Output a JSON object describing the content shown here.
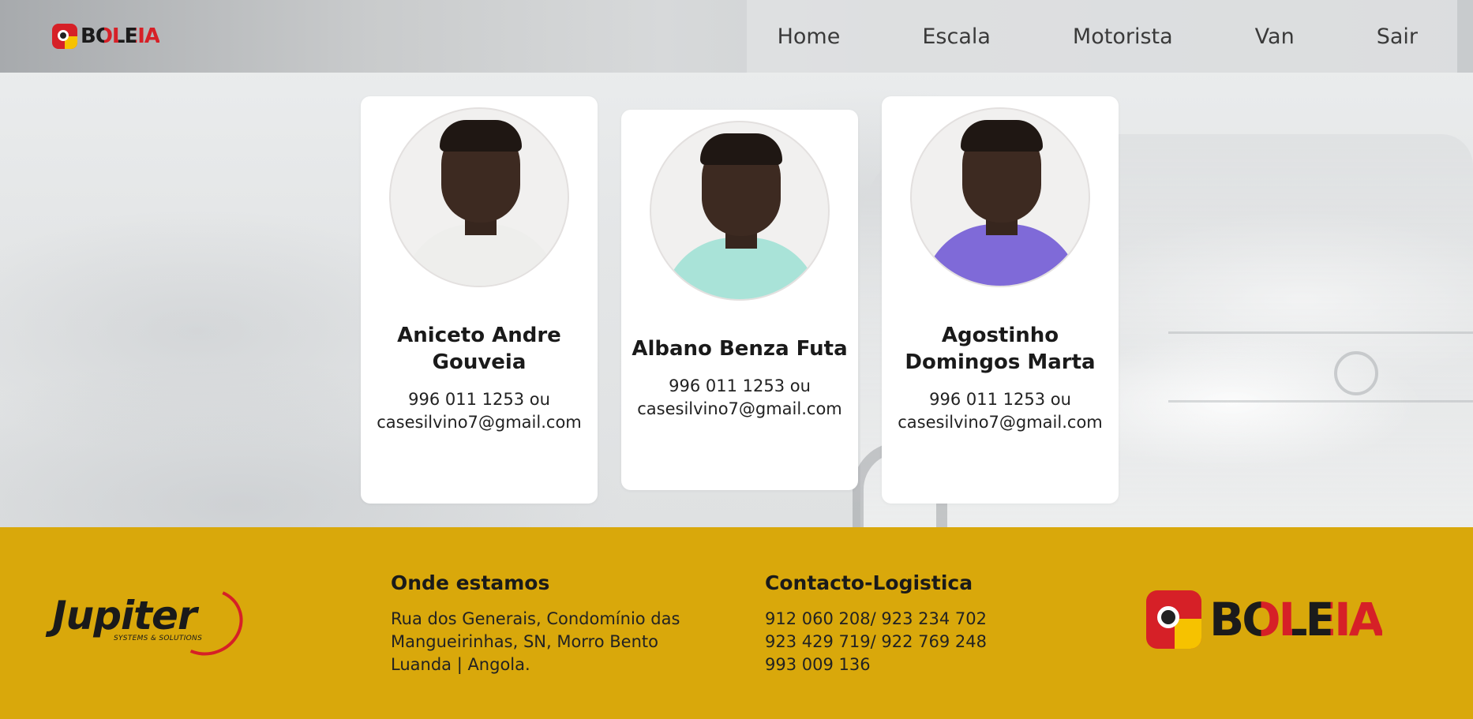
{
  "header": {
    "logo_text": "BOLEIA",
    "nav": [
      {
        "label": "Home"
      },
      {
        "label": "Escala"
      },
      {
        "label": "Motorista"
      },
      {
        "label": "Van"
      },
      {
        "label": "Sair"
      }
    ]
  },
  "drivers": [
    {
      "name_line1": "Aniceto Andre",
      "name_line2": "Gouveia",
      "phone": "996 011 1253 ou",
      "email": "casesilvino7@gmail.com",
      "shirt_color": "#eeeeec"
    },
    {
      "name_line1": "Albano Benza Futa",
      "name_line2": "",
      "phone": "996 011 1253 ou",
      "email": "casesilvino7@gmail.com",
      "shirt_color": "#a9e3d8"
    },
    {
      "name_line1": "Agostinho",
      "name_line2": "Domingos Marta",
      "phone": "996 011 1253 ou",
      "email": "casesilvino7@gmail.com",
      "shirt_color": "#7f6ad8"
    }
  ],
  "footer": {
    "partner_logo": {
      "word": "Jupiter",
      "tagline": "SYSTEMS & SOLUTIONS"
    },
    "location": {
      "title": "Onde estamos",
      "lines": [
        "Rua dos Generais, Condomínio das",
        "Mangueirinhas, SN, Morro Bento",
        "Luanda | Angola."
      ]
    },
    "contact": {
      "title": "Contacto-Logistica",
      "lines": [
        "912 060 208/ 923 234 702",
        "923 429 719/ 922 769 248",
        "993 009 136"
      ]
    },
    "brand_logo_text": "BOLEIA",
    "background_color": "#d9a80b"
  },
  "colors": {
    "brand_red": "#d62027",
    "brand_yellow": "#f6c200"
  }
}
